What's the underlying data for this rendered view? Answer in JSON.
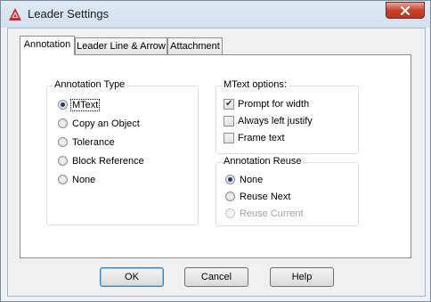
{
  "window": {
    "title": "Leader Settings"
  },
  "tabs": [
    {
      "label": "Annotation",
      "active": true
    },
    {
      "label": "Leader Line & Arrow",
      "active": false
    },
    {
      "label": "Attachment",
      "active": false
    }
  ],
  "annotation_type": {
    "title": "Annotation Type",
    "options": [
      {
        "label": "MText",
        "checked": true
      },
      {
        "label": "Copy an Object",
        "checked": false
      },
      {
        "label": "Tolerance",
        "checked": false
      },
      {
        "label": "Block Reference",
        "checked": false
      },
      {
        "label": "None",
        "checked": false
      }
    ]
  },
  "mtext_options": {
    "title": "MText options:",
    "options": [
      {
        "label": "Prompt for width",
        "checked": true
      },
      {
        "label": "Always left justify",
        "checked": false
      },
      {
        "label": "Frame text",
        "checked": false
      }
    ]
  },
  "annotation_reuse": {
    "title": "Annotation Reuse",
    "options": [
      {
        "label": "None",
        "checked": true,
        "disabled": false
      },
      {
        "label": "Reuse Next",
        "checked": false,
        "disabled": false
      },
      {
        "label": "Reuse Current",
        "checked": false,
        "disabled": true
      }
    ]
  },
  "buttons": {
    "ok": "OK",
    "cancel": "Cancel",
    "help": "Help"
  },
  "colors": {
    "close_button": "#c7432f",
    "app_icon": "#d0262b"
  },
  "icons": {
    "app": "autocad-icon",
    "close": "close-icon"
  }
}
